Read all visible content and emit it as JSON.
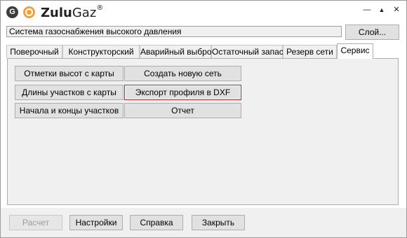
{
  "titlebar": {
    "logo_letter": "G",
    "app_name_bold": "Zulu",
    "app_name_light": "Gaz",
    "trademark": "®",
    "controls": {
      "minimize": "—",
      "maximize": "▲",
      "close": "✕"
    }
  },
  "system": {
    "name": "Система газоснабжения высокого давления",
    "layer_button": "Слой..."
  },
  "tabs": [
    {
      "label": "Поверочный",
      "active": false
    },
    {
      "label": "Конструкторский",
      "active": false
    },
    {
      "label": "Аварийный выброс",
      "active": false
    },
    {
      "label": "Остаточный запас",
      "active": false
    },
    {
      "label": "Резерв сети",
      "active": false
    },
    {
      "label": "Сервис",
      "active": true
    }
  ],
  "service": {
    "left_buttons": [
      "Отметки высот с карты",
      "Длины участков с карты",
      "Начала и концы участков"
    ],
    "right_buttons": [
      "Создать новую сеть",
      "Экспорт профиля в DXF",
      "Отчет"
    ]
  },
  "footer": {
    "calculate": "Расчет",
    "settings": "Настройки",
    "help": "Справка",
    "close": "Закрыть"
  },
  "colors": {
    "focus_border": "#c81e1e",
    "logo_orange": "#f0a13a",
    "panel_bg": "#f0f0f0"
  }
}
